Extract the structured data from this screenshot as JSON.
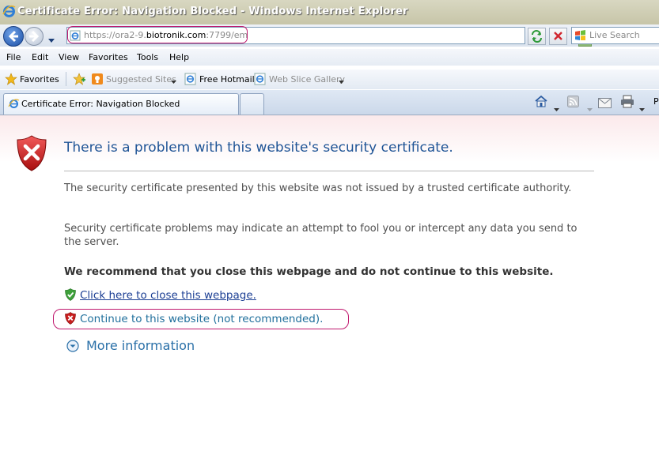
{
  "window": {
    "title": "Certificate Error: Navigation Blocked - Windows Internet Explorer"
  },
  "address": {
    "url_prefix": "https://ora2-9.",
    "url_domain": "biotronik.com",
    "url_suffix": ":7799/em"
  },
  "search": {
    "placeholder": "Live Search"
  },
  "menu": [
    "File",
    "Edit",
    "View",
    "Favorites",
    "Tools",
    "Help"
  ],
  "favorites_bar": {
    "favorites_label": "Favorites",
    "suggested_sites": "Suggested Sites",
    "free_hotmail": "Free Hotmail",
    "web_slice_gallery": "Web Slice Gallery"
  },
  "tab": {
    "label": "Certificate Error: Navigation Blocked"
  },
  "command_bar": {
    "page_label": "P"
  },
  "content": {
    "heading": "There is a problem with this website's security certificate.",
    "para1": "The security certificate presented by this website was not issued by a trusted certificate authority.",
    "para2": "Security certificate problems may indicate an attempt to fool you or intercept any data you send to the server.",
    "recommend": "We recommend that you close this webpage and do not continue to this website.",
    "close_link": "Click here to close this webpage.",
    "continue_link": "Continue to this website (not recommended).",
    "more_info": "More information"
  },
  "colors": {
    "heading": "#1f5496",
    "link": "#1c3f94",
    "annotation": "#c0186e"
  }
}
